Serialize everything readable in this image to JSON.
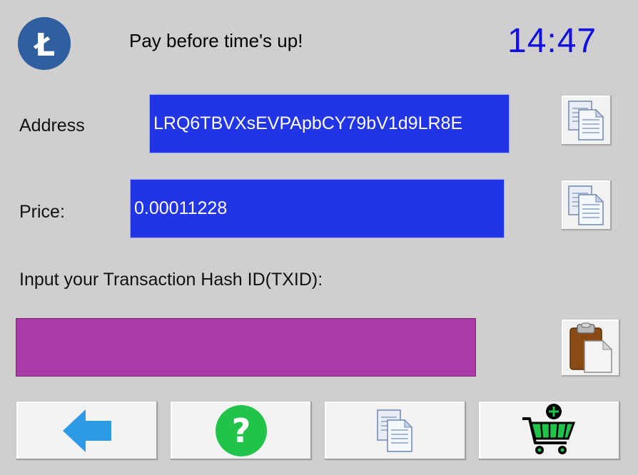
{
  "header": {
    "logo_icon": "litecoin-logo-icon",
    "logo_letter": "Ł",
    "title": "Pay before time's up!",
    "timer": "14:47",
    "timer_color": "#1010e0"
  },
  "address": {
    "label": "Address",
    "value": "LRQ6TBVXsEVPApbCY79bV1d9LR8E",
    "copy_icon": "copy-icon"
  },
  "price": {
    "label": "Price:",
    "value": "0.00011228",
    "copy_icon": "copy-icon"
  },
  "txid": {
    "label": "Input your Transaction Hash ID(TXID):",
    "value": "",
    "paste_icon": "clipboard-paste-icon"
  },
  "bottom_buttons": {
    "back_icon": "arrow-left-icon",
    "help_icon": "question-mark-icon",
    "help_glyph": "?",
    "copy_icon": "copy-icon",
    "cart_icon": "add-to-cart-icon"
  },
  "colors": {
    "background": "#cfcfcf",
    "field_blue": "#2235e6",
    "txid_field": "#aa3aa6",
    "logo_blue": "#2f5f9f",
    "help_green": "#22c34a",
    "back_arrow": "#2e9be6"
  }
}
